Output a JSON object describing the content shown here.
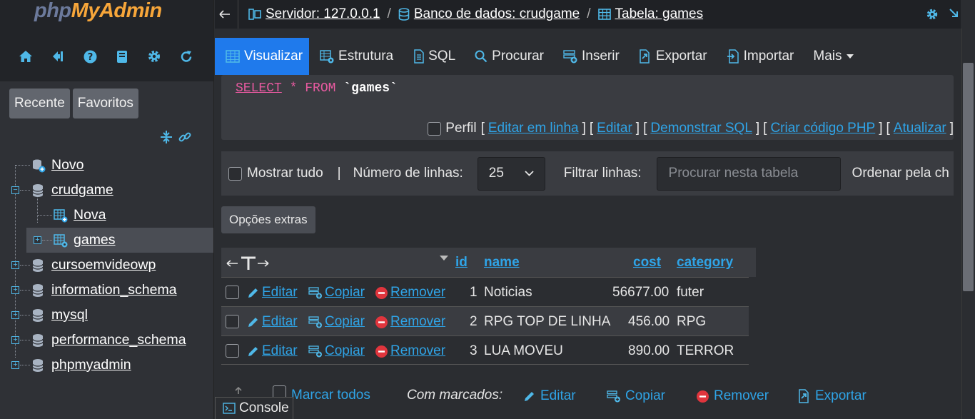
{
  "app": {
    "logo_php": "php",
    "logo_my": "MyAdmin"
  },
  "sidebar": {
    "nav_icons": [
      "home-icon",
      "logout-icon",
      "help-icon",
      "docs-icon",
      "settings-icon",
      "reload-icon"
    ],
    "tabs": {
      "recent": "Recente",
      "favorites": "Favoritos"
    },
    "tree": [
      {
        "label": "Novo"
      },
      {
        "label": "crudgame"
      },
      {
        "label": "Nova"
      },
      {
        "label": "games"
      },
      {
        "label": "cursoemvideowp"
      },
      {
        "label": "information_schema"
      },
      {
        "label": "mysql"
      },
      {
        "label": "performance_schema"
      },
      {
        "label": "phpmyadmin"
      }
    ]
  },
  "breadcrumb": {
    "server": "Servidor: 127.0.0.1",
    "database": "Banco de dados: crudgame",
    "table": "Tabela: games",
    "separator": "/"
  },
  "menu": {
    "tabs": [
      "Visualizar",
      "Estrutura",
      "SQL",
      "Procurar",
      "Inserir",
      "Exportar",
      "Importar",
      "Mais"
    ],
    "active": "Visualizar"
  },
  "sql": {
    "select": "SELECT",
    "star": "*",
    "from": "FROM",
    "table": "`games`",
    "profile": "Perfil",
    "links": [
      "Editar em linha",
      "Editar",
      "Demonstrar SQL",
      "Criar código PHP",
      "Atualizar"
    ],
    "bracket_open": "[",
    "bracket_close": "]"
  },
  "filter": {
    "show_all": "Mostrar tudo",
    "divider": "|",
    "rows_label": "Número de linhas:",
    "rows_value": "25",
    "filter_label": "Filtrar linhas:",
    "search_placeholder": "Procurar nesta tabela",
    "sort_label": "Ordenar pela ch"
  },
  "extra_options": "Opções extras",
  "table": {
    "columns": [
      "id",
      "name",
      "cost",
      "category"
    ],
    "actions": {
      "edit": "Editar",
      "copy": "Copiar",
      "delete": "Remover"
    },
    "rows": [
      {
        "id": "1",
        "name": "Noticias",
        "cost": "56677.00",
        "category": "futer"
      },
      {
        "id": "2",
        "name": "RPG TOP DE LINHA",
        "cost": "456.00",
        "category": "RPG"
      },
      {
        "id": "3",
        "name": "LUA MOVEU",
        "cost": "890.00",
        "category": "TERROR"
      }
    ]
  },
  "bottom": {
    "check_all": "Marcar todos",
    "with_selected": "Com marcados:",
    "edit": "Editar",
    "copy": "Copiar",
    "delete": "Remover",
    "export": "Exportar"
  },
  "console": "Console",
  "colors": {
    "accent": "#1f7aec",
    "link": "#2fa4e7",
    "danger": "#e0353d"
  }
}
